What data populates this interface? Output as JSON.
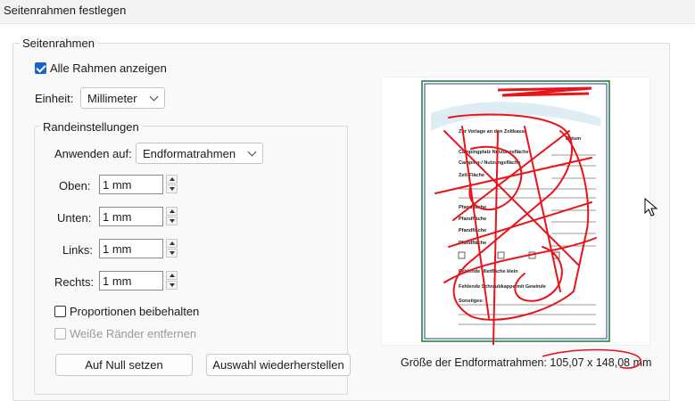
{
  "window": {
    "title": "Seitenrahmen festlegen"
  },
  "group_title": "Seitenrahmen",
  "show_all_frames": {
    "label": "Alle Rahmen anzeigen",
    "checked": true
  },
  "unit": {
    "label": "Einheit:",
    "value": "Millimeter"
  },
  "margins": {
    "title": "Randeinstellungen",
    "apply_to": {
      "label": "Anwenden auf:",
      "value": "Endformatrahmen"
    },
    "fields": [
      {
        "label": "Oben:",
        "value": "1 mm"
      },
      {
        "label": "Unten:",
        "value": "1 mm"
      },
      {
        "label": "Links:",
        "value": "1 mm"
      },
      {
        "label": "Rechts:",
        "value": "1 mm"
      }
    ],
    "keep_proportions": {
      "label": "Proportionen beibehalten",
      "checked": false
    },
    "remove_white_margins": {
      "label": "Weiße Ränder entfernen",
      "checked": false,
      "disabled": true
    }
  },
  "buttons": {
    "reset": "Auf Null setzen",
    "restore": "Auswahl wiederherstellen"
  },
  "preview": {
    "caption": "Größe der Endformatrahmen: 105,07 x 148,08 mm",
    "document_text": [
      "Zur Vorlage an den Zoltkasse",
      "Datum",
      "Campingplatz Nutzungsfläche",
      "Camping-/ Nutzungsfläche",
      "Zelt-Fläche",
      "Pfandfläche",
      "Pfandfläche",
      "Pfandfläche",
      "Pfandfläche",
      "Pfandfläche",
      "Fehlende Mietfläche klein",
      "Fehlende Schraubkappe mit Gewinde",
      "Sonstiges:"
    ]
  },
  "colors": {
    "accent": "#1a63c9",
    "annotation": "#e8141a",
    "frame_green": "#1f7a2e",
    "frame_blue": "#1a3fa8"
  }
}
